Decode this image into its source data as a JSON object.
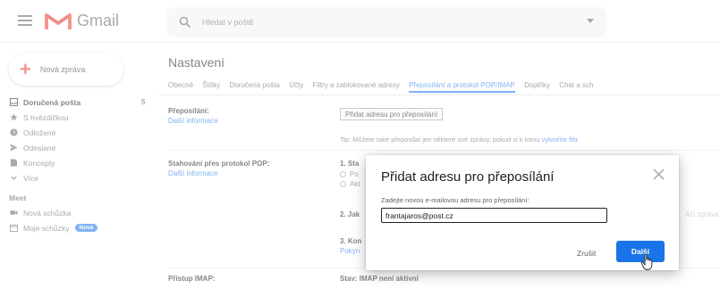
{
  "app": {
    "name": "Gmail"
  },
  "search": {
    "placeholder": "Hledat v poště"
  },
  "compose": {
    "label": "Nová zpráva"
  },
  "sidebar": {
    "items": [
      {
        "label": "Doručená pošta",
        "icon": "inbox-icon",
        "count": "5",
        "active": true
      },
      {
        "label": "S hvězdičkou",
        "icon": "star-icon"
      },
      {
        "label": "Odložené",
        "icon": "clock-icon"
      },
      {
        "label": "Odeslané",
        "icon": "send-icon"
      },
      {
        "label": "Koncepty",
        "icon": "draft-icon"
      },
      {
        "label": "Více",
        "icon": "chevron-down-icon"
      }
    ],
    "meet": {
      "header": "Meet",
      "items": [
        {
          "label": "Nová schůzka",
          "icon": "video-icon"
        },
        {
          "label": "Moje schůzky",
          "icon": "calendar-icon",
          "badge": "Nové"
        }
      ]
    }
  },
  "settings": {
    "title": "Nastavení",
    "tabs": [
      {
        "label": "Obecné"
      },
      {
        "label": "Štítky"
      },
      {
        "label": "Doručená pošta"
      },
      {
        "label": "Účty"
      },
      {
        "label": "Filtry a zablokované adresy"
      },
      {
        "label": "Přeposílání a protokol POP/IMAP",
        "active": true
      },
      {
        "label": "Doplňky"
      },
      {
        "label": "Chat a sch"
      }
    ],
    "forwarding": {
      "label": "Přeposílání:",
      "link": "Další informace",
      "button": "Přidat adresu pro přeposílání",
      "tip": "Tip: Můžete také přeposílat jen některé své zprávy, pokud si k tomu",
      "tip_link": "vytvoříte filtr."
    },
    "pop": {
      "label": "Stahování přes protokol POP:",
      "link": "Další informace",
      "step1": "1. Sta",
      "opt1": "Po",
      "opt2": "Akt",
      "step2": "2. Jak",
      "step3": "3. Kon",
      "step3_link": "Pokyn",
      "right_faded": "Ači zpráva"
    },
    "imap": {
      "label": "Přístup IMAP:",
      "status": "Stav: IMAP není aktivní"
    }
  },
  "dialog": {
    "title": "Přidat adresu pro přeposílání",
    "hint": "Zadejte novou e-mailovou adresu pro přeposílání:",
    "input_value": "frantajaros@post.cz",
    "cancel": "Zrušit",
    "next": "Další"
  },
  "colors": {
    "accent": "#1a73e8",
    "gmail_red": "#ea4335"
  }
}
